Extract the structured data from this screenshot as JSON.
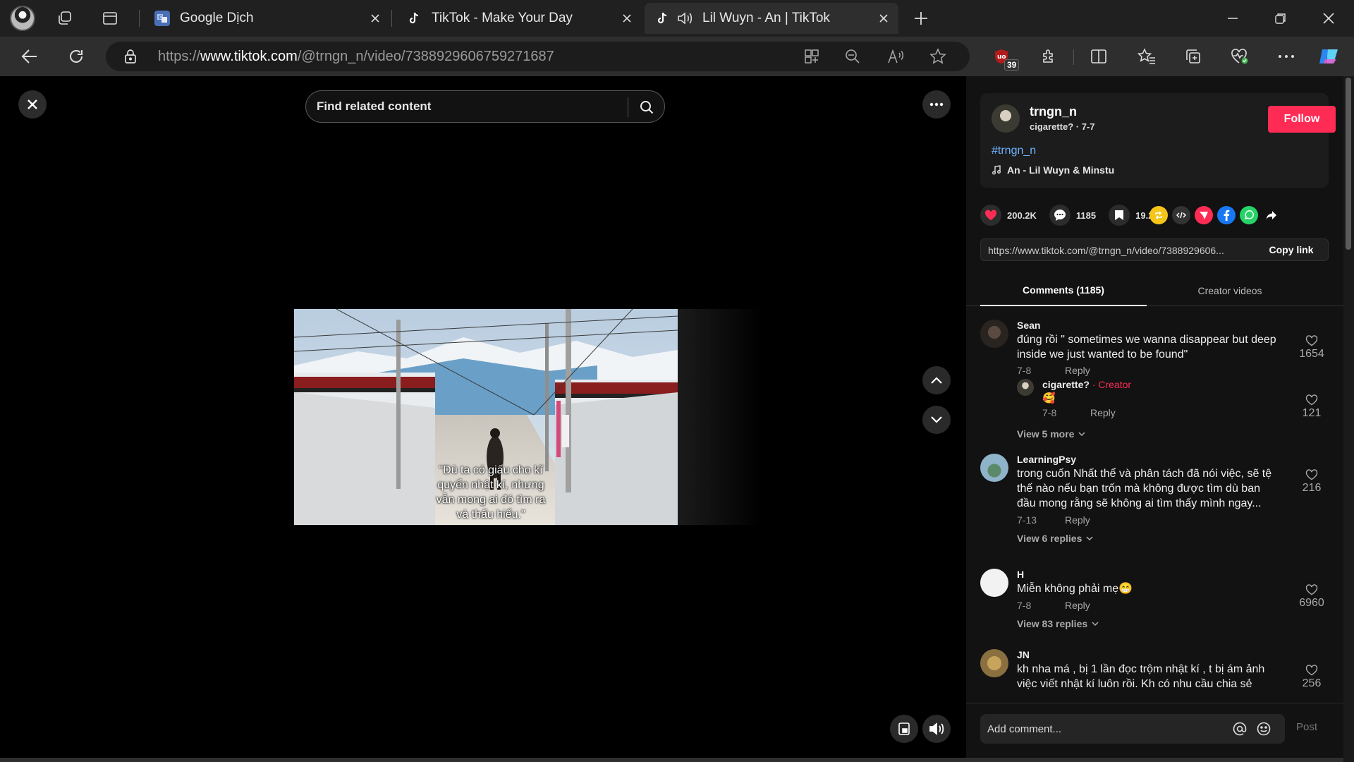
{
  "browser": {
    "tabs": [
      {
        "title": "Google Dịch",
        "active": false
      },
      {
        "title": "TikTok - Make Your Day",
        "active": false
      },
      {
        "title": "Lil Wuyn - An | TikTok",
        "active": true
      }
    ],
    "url_prefix": "https://",
    "url_domain": "www.tiktok.com",
    "url_path": "/@trngn_n/video/7388929606759271687",
    "extension_badge": "39",
    "accent_color": "#2e2e2e"
  },
  "video": {
    "search_placeholder": "Find related content",
    "caption": "\"Dù ta có giấu cho kĩ quyển nhật kí, nhưng vẫn mong ai đó tìm ra và thấu hiểu.\""
  },
  "creator": {
    "username": "trngn_n",
    "nickname": "cigarette?",
    "date": "7-7",
    "follow_label": "Follow",
    "hashtag": "#trngn_n",
    "music": "An - Lil Wuyn & Minstu",
    "follow_color": "#fe2c55"
  },
  "stats": {
    "likes": "200.2K",
    "comments": "1185",
    "saves": "19.2K"
  },
  "share": {
    "link": "https://www.tiktok.com/@trngn_n/video/7388929606...",
    "copy_label": "Copy link"
  },
  "tabs": {
    "comments": "Comments (1185)",
    "creator_videos": "Creator videos"
  },
  "comments": [
    {
      "name": "Sean",
      "text": "đúng rồi \" sometimes we wanna disappear but deep inside we just wanted to be found\"",
      "date": "7-8",
      "reply": "Reply",
      "likes": "1654",
      "reply_item": {
        "name": "cigarette?",
        "creator_tag": " · Creator",
        "text": "🥰",
        "date": "7-8",
        "reply": "Reply",
        "likes": "121"
      },
      "more": "View 5 more"
    },
    {
      "name": "LearningPsy",
      "text": "trong cuốn Nhất thể và phân tách đã nói việc, sẽ tệ thế nào nếu bạn trốn mà không được tìm dù ban đầu mong rằng sẽ không ai tìm thấy mình ngay...",
      "date": "7-13",
      "reply": "Reply",
      "likes": "216",
      "more": "View 6 replies"
    },
    {
      "name": "H",
      "text": "Miễn không phải mẹ😁",
      "date": "7-8",
      "reply": "Reply",
      "likes": "6960",
      "more": "View 83 replies"
    },
    {
      "name": "JN",
      "text": "kh nha má , bị 1 lần đọc trộm nhật kí , t bị ám ảnh việc viết nhật kí luôn rồi. Kh có nhu cầu chia sẻ",
      "likes": "256"
    }
  ],
  "composer": {
    "placeholder": "Add comment...",
    "post_label": "Post"
  }
}
